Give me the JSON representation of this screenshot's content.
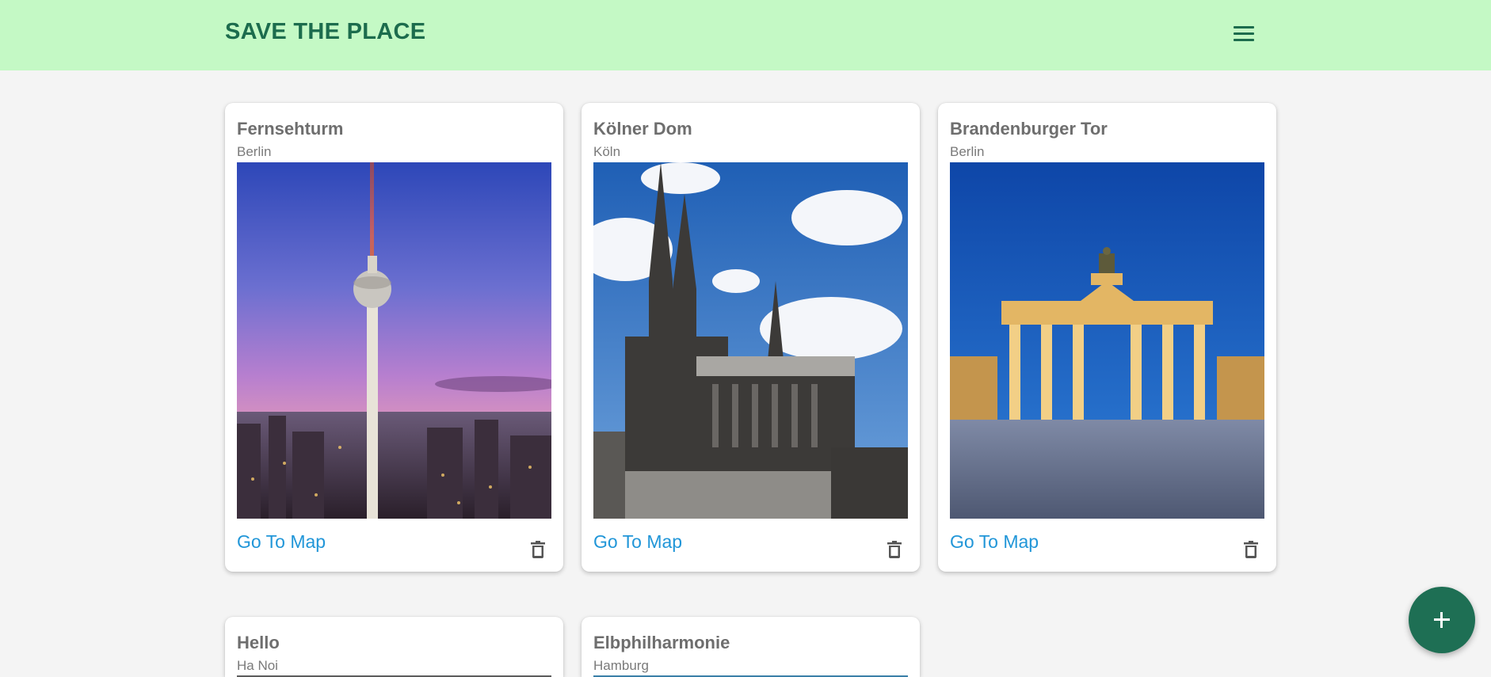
{
  "header": {
    "title": "SAVE THE PLACE",
    "menu_icon": "hamburger-menu-icon",
    "background": "#c4f9c5",
    "title_color": "#1c6c4d"
  },
  "places": [
    {
      "title": "Fernsehturm",
      "city": "Berlin",
      "link_label": "Go To Map",
      "image": "berlin-tv-tower-photo"
    },
    {
      "title": "Kölner Dom",
      "city": "Köln",
      "link_label": "Go To Map",
      "image": "cologne-cathedral-photo"
    },
    {
      "title": "Brandenburger Tor",
      "city": "Berlin",
      "link_label": "Go To Map",
      "image": "brandenburg-gate-photo"
    },
    {
      "title": "Hello",
      "city": "Ha Noi"
    },
    {
      "title": "Elbphilharmonie",
      "city": "Hamburg"
    }
  ],
  "fab": {
    "icon": "plus-icon",
    "color": "#1e6f54"
  },
  "link_color": "#2196d8"
}
